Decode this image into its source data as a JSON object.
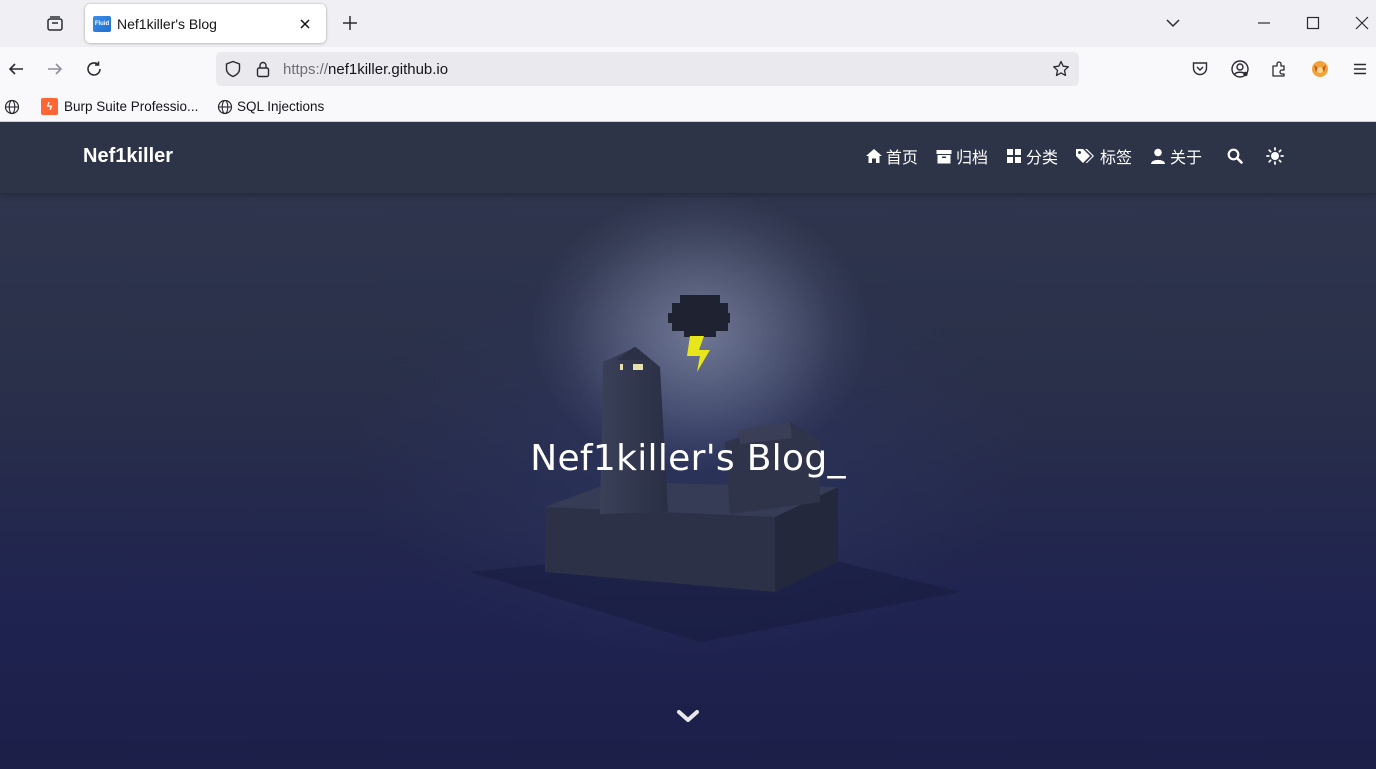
{
  "browser": {
    "tab": {
      "title": "Nef1killer's Blog",
      "favicon_text": "Fluid"
    },
    "url": {
      "protocol": "https://",
      "host": "nef1killer.github.io"
    },
    "bookmarks": [
      {
        "label": "Burp Suite Professio...",
        "icon": "burp-icon"
      },
      {
        "label": "SQL Injections",
        "icon": "globe-icon"
      }
    ],
    "icons": [
      "tab-list-icon",
      "close-icon",
      "plus-icon",
      "chevron-down-icon",
      "minimize-icon",
      "maximize-icon",
      "window-close-icon",
      "back-icon",
      "forward-icon",
      "reload-icon",
      "shield-icon",
      "lock-icon",
      "star-icon",
      "pocket-icon",
      "account-icon",
      "extensions-icon",
      "extension-fox-icon",
      "menu-icon",
      "globe-icon"
    ]
  },
  "site": {
    "brand": "Nef1killer",
    "menu": [
      {
        "label": "首页",
        "icon": "home-icon"
      },
      {
        "label": "归档",
        "icon": "archive-icon"
      },
      {
        "label": "分类",
        "icon": "categories-icon"
      },
      {
        "label": "标签",
        "icon": "tags-icon"
      },
      {
        "label": "关于",
        "icon": "user-icon"
      }
    ],
    "search_icon": "search-icon",
    "theme_icon": "sun-icon",
    "hero_title": "Nef1killer's Blog_",
    "scroll_icon": "chevron-down-icon",
    "colors": {
      "header_bg": "#2d3446",
      "hero_bg_top": "#30374f",
      "hero_bg_bottom": "#1c1f48",
      "bolt": "#e6e61a"
    }
  }
}
